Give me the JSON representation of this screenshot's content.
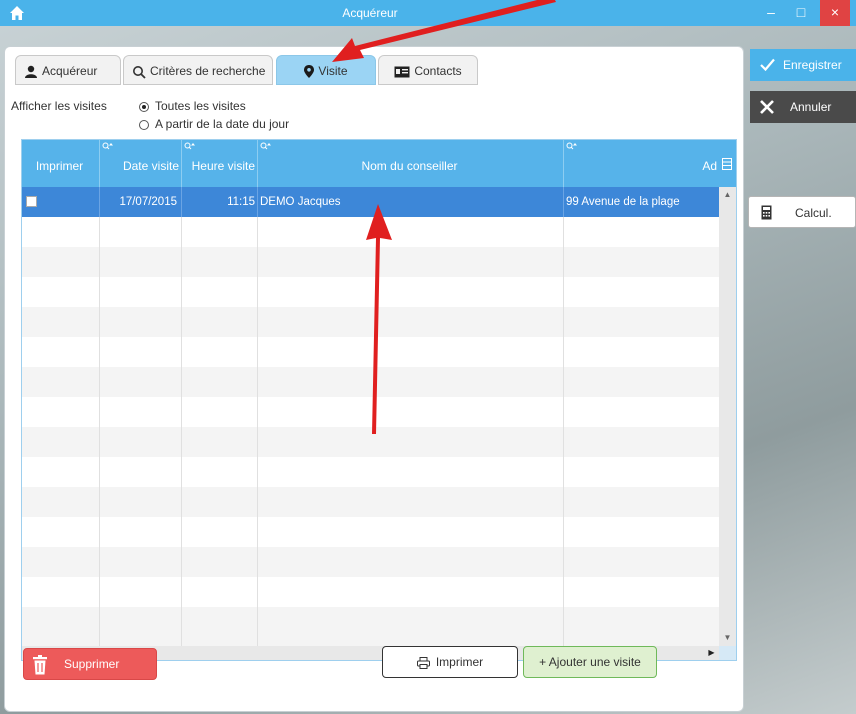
{
  "window": {
    "title": "Acquéreur",
    "minimize": "–",
    "maximize": "□",
    "close": "×"
  },
  "tabs": [
    {
      "label": "Acquéreur",
      "icon": "user-icon",
      "active": false
    },
    {
      "label": "Critères de recherche",
      "icon": "search-icon",
      "active": false
    },
    {
      "label": "Visite",
      "icon": "map-pin-icon",
      "active": true
    },
    {
      "label": "Contacts",
      "icon": "contact-card-icon",
      "active": false
    }
  ],
  "filter": {
    "label": "Afficher les visites",
    "options": [
      {
        "label": "Toutes les visites",
        "selected": true
      },
      {
        "label": "A partir de la date du jour",
        "selected": false
      }
    ]
  },
  "grid": {
    "columns": [
      "Imprimer",
      "Date visite",
      "Heure visite",
      "Nom du conseiller",
      "Ad"
    ],
    "rows": [
      {
        "imprimer": false,
        "date": "17/07/2015",
        "heure": "11:15",
        "conseiller": "DEMO Jacques",
        "adresse": "99 Avenue de la plage"
      }
    ]
  },
  "buttons": {
    "delete": "Supprimer",
    "print": "Imprimer",
    "add": "+ Ajouter une visite"
  },
  "side": {
    "save": "Enregistrer",
    "cancel": "Annuler",
    "calc": "Calcul."
  },
  "colors": {
    "accent": "#4ab3ea",
    "selection": "#3d87d8",
    "delete": "#ed5a5a",
    "add": "#dff0d0",
    "annotation_arrow": "#e01f1f"
  }
}
